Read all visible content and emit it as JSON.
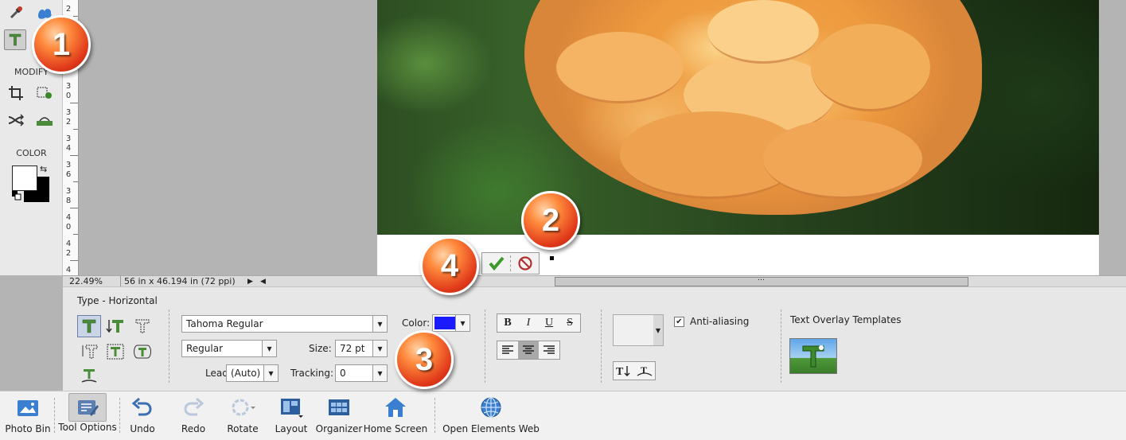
{
  "toolbox": {
    "modify_label": "MODIFY",
    "color_label": "COLOR"
  },
  "ruler": {
    "labels": [
      "2",
      "3",
      "0",
      "3",
      "2",
      "3",
      "4",
      "3",
      "6",
      "3",
      "8",
      "4",
      "0",
      "4",
      "2",
      "4"
    ]
  },
  "status": {
    "zoom": "22.49%",
    "dimensions": "56 in x 46.194 in (72 ppi)"
  },
  "options": {
    "title": "Type - Horizontal",
    "font_family": "Tahoma Regular",
    "font_style": "Regular",
    "color_label": "Color:",
    "color_value": "#1a1aff",
    "size_label": "Size:",
    "size_value": "72 pt",
    "leading_label": "Leading:",
    "leading_value": "(Auto)",
    "tracking_label": "Tracking:",
    "tracking_value": "0",
    "format_buttons": [
      "B",
      "I",
      "U",
      "S"
    ],
    "anti_aliasing_label": "Anti-aliasing",
    "anti_aliasing_checked": true,
    "templates_label": "Text Overlay Templates"
  },
  "taskbar": {
    "photo_bin": "Photo Bin",
    "tool_options": "Tool Options",
    "undo": "Undo",
    "redo": "Redo",
    "rotate": "Rotate",
    "layout": "Layout",
    "organizer": "Organizer",
    "home_screen": "Home Screen",
    "open_elements_web": "Open Elements Web"
  },
  "callouts": [
    "1",
    "2",
    "3",
    "4"
  ]
}
